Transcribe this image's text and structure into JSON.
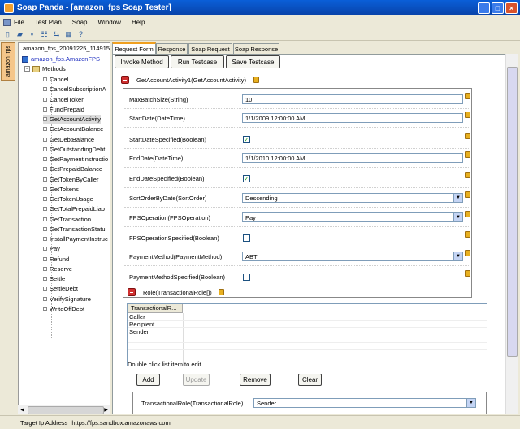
{
  "window": {
    "title": "Soap Panda - [amazon_fps Soap Tester]"
  },
  "menu": [
    "File",
    "Test Plan",
    "Soap",
    "Window",
    "Help"
  ],
  "side_tab": "amazon_fps",
  "tree": {
    "root": "amazon_fps_20091225_114915",
    "service": "amazon_fps.AmazonFPS",
    "methods_label": "Methods",
    "methods": [
      "Cancel",
      "CancelSubscriptionA",
      "CancelToken",
      "FundPrepaid",
      "GetAccountActivity",
      "GetAccountBalance",
      "GetDebtBalance",
      "GetOutstandingDebt",
      "GetPaymentInstructio",
      "GetPrepaidBalance",
      "GetTokenByCaller",
      "GetTokens",
      "GetTokenUsage",
      "GetTotalPrepaidLiab",
      "GetTransaction",
      "GetTransactionStatu",
      "InstallPaymentInstruc",
      "Pay",
      "Refund",
      "Reserve",
      "Settle",
      "SettleDebt",
      "VerifySignature",
      "WriteOffDebt"
    ],
    "selected": "GetAccountActivity"
  },
  "tabs": [
    "Request Form",
    "Response",
    "Soap Request",
    "Soap Response"
  ],
  "actions": [
    "Invoke Method",
    "Run Testcase",
    "Save Testcase"
  ],
  "operation": "GetAccountActivity1(GetAccountActivity)",
  "fields": [
    {
      "label": "MaxBatchSize(String)",
      "kind": "text",
      "value": "10"
    },
    {
      "label": "StartDate(DateTime)",
      "kind": "text",
      "value": "1/1/2009 12:00:00 AM"
    },
    {
      "label": "StartDateSpecified(Boolean)",
      "kind": "check",
      "checked": true
    },
    {
      "label": "EndDate(DateTime)",
      "kind": "text",
      "value": "1/1/2010 12:00:00 AM"
    },
    {
      "label": "EndDateSpecified(Boolean)",
      "kind": "check",
      "checked": true
    },
    {
      "label": "SortOrderByDate(SortOrder)",
      "kind": "combo",
      "value": "Descending"
    },
    {
      "label": "FPSOperation(FPSOperation)",
      "kind": "combo",
      "value": "Pay"
    },
    {
      "label": "FPSOperationSpecified(Boolean)",
      "kind": "check",
      "checked": false
    },
    {
      "label": "PaymentMethod(PaymentMethod)",
      "kind": "combo",
      "value": "ABT"
    },
    {
      "label": "PaymentMethodSpecified(Boolean)",
      "kind": "check",
      "checked": false
    }
  ],
  "role": {
    "title": "Role(TransactionalRole[])",
    "column": "TransactionalR...",
    "items": [
      "Caller",
      "Recipient",
      "Sender"
    ],
    "hint": "Double click list item to edit",
    "buttons": [
      "Add",
      "Update",
      "Remove",
      "Clear"
    ],
    "editor_label": "TransactionalRole(TransactionalRole)",
    "editor_value": "Sender"
  },
  "status": {
    "label": "Target Ip Address",
    "value": "https://fps.sandbox.amazonaws.com"
  }
}
